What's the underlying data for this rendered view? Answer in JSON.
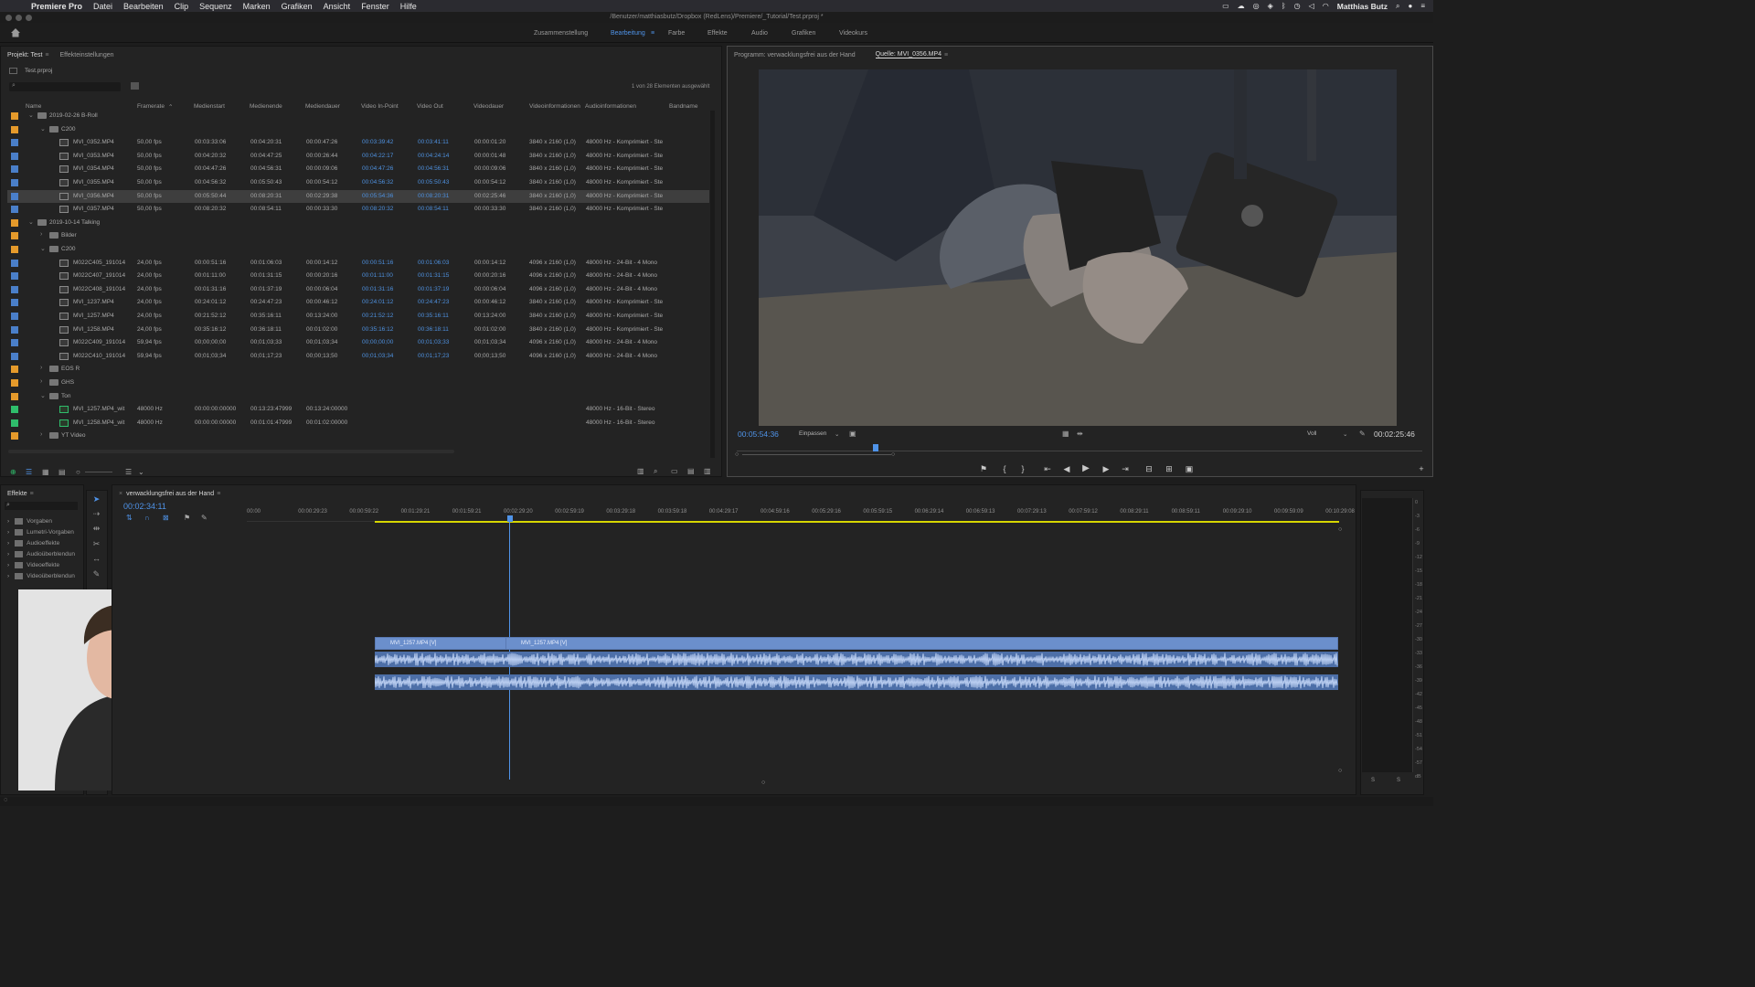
{
  "menubar": {
    "apple": "",
    "app": "Premiere Pro",
    "items": [
      "Datei",
      "Bearbeiten",
      "Clip",
      "Sequenz",
      "Marken",
      "Grafiken",
      "Ansicht",
      "Fenster",
      "Hilfe"
    ],
    "user": "Matthias Butz"
  },
  "window": {
    "title": "/Benutzer/matthiasbutz/Dropbox (RedLens)/Premiere/_Tutorial/Test.prproj *"
  },
  "workspaces": {
    "items": [
      "Zusammenstellung",
      "Bearbeitung",
      "Farbe",
      "Effekte",
      "Audio",
      "Grafiken",
      "Videokurs"
    ],
    "active": "Bearbeitung"
  },
  "project": {
    "tab_project": "Projekt: Test",
    "tab_effects": "Effekteinstellungen",
    "file": "Test.prproj",
    "selection_info": "1 von 28 Elementen ausgewählt",
    "columns": [
      "Name",
      "Framerate",
      "Medienstart",
      "Medienende",
      "Mediendauer",
      "Video In-Point",
      "Video Out",
      "Videodauer",
      "Videoinformationen",
      "Audioinformationen",
      "Bandname"
    ],
    "rows": [
      {
        "type": "folder",
        "indent": 1,
        "open": true,
        "color": "#e59a2b",
        "name": "2019-02-26 B-Roll"
      },
      {
        "type": "folder",
        "indent": 2,
        "open": true,
        "color": "#e59a2b",
        "name": "C200"
      },
      {
        "type": "clip",
        "indent": 3,
        "color": "#4a7fc9",
        "name": "MVI_0352.MP4",
        "fr": "50,00 fps",
        "ms": "00:03:33:06",
        "me": "00:04:20:31",
        "md": "00:00:47:26",
        "vi": "00:03:39:42",
        "vo": "00:03:41:11",
        "vd": "00:00:01:20",
        "vinfo": "3840 x 2160 (1,0)",
        "ainfo": "48000 Hz - Komprimiert - Ste"
      },
      {
        "type": "clip",
        "indent": 3,
        "color": "#4a7fc9",
        "name": "MVI_0353.MP4",
        "fr": "50,00 fps",
        "ms": "00:04:20:32",
        "me": "00:04:47:25",
        "md": "00:00:26:44",
        "vi": "00:04:22:17",
        "vo": "00:04:24:14",
        "vd": "00:00:01:48",
        "vinfo": "3840 x 2160 (1,0)",
        "ainfo": "48000 Hz - Komprimiert - Ste"
      },
      {
        "type": "clip",
        "indent": 3,
        "color": "#4a7fc9",
        "name": "MVI_0354.MP4",
        "fr": "50,00 fps",
        "ms": "00:04:47:26",
        "me": "00:04:56:31",
        "md": "00:00:09:06",
        "vi": "00:04:47:26",
        "vo": "00:04:56:31",
        "vd": "00:00:09:06",
        "vinfo": "3840 x 2160 (1,0)",
        "ainfo": "48000 Hz - Komprimiert - Ste"
      },
      {
        "type": "clip",
        "indent": 3,
        "color": "#4a7fc9",
        "name": "MVI_0355.MP4",
        "fr": "50,00 fps",
        "ms": "00:04:56:32",
        "me": "00:05:50:43",
        "md": "00:00:54:12",
        "vi": "00:04:56:32",
        "vo": "00:05:50:43",
        "vd": "00:00:54:12",
        "vinfo": "3840 x 2160 (1,0)",
        "ainfo": "48000 Hz - Komprimiert - Ste"
      },
      {
        "type": "clip",
        "indent": 3,
        "color": "#4a7fc9",
        "sel": true,
        "name": "MVI_0356.MP4",
        "fr": "50,00 fps",
        "ms": "00:05:50:44",
        "me": "00:08:20:31",
        "md": "00:02:29:38",
        "vi": "00:05:54:36",
        "vo": "00:08:20:31",
        "vd": "00:02:25:46",
        "vinfo": "3840 x 2160 (1,0)",
        "ainfo": "48000 Hz - Komprimiert - Ste"
      },
      {
        "type": "clip",
        "indent": 3,
        "color": "#4a7fc9",
        "name": "MVI_0357.MP4",
        "fr": "50,00 fps",
        "ms": "00:08:20:32",
        "me": "00:08:54:11",
        "md": "00:00:33:30",
        "vi": "00:08:20:32",
        "vo": "00:08:54:11",
        "vd": "00:00:33:30",
        "vinfo": "3840 x 2160 (1,0)",
        "ainfo": "48000 Hz - Komprimiert - Ste"
      },
      {
        "type": "folder",
        "indent": 1,
        "open": true,
        "color": "#e59a2b",
        "name": "2019-10-14 Talking"
      },
      {
        "type": "folder",
        "indent": 2,
        "open": false,
        "color": "#e59a2b",
        "name": "Bilder"
      },
      {
        "type": "folder",
        "indent": 2,
        "open": true,
        "color": "#e59a2b",
        "name": "C200"
      },
      {
        "type": "clip",
        "indent": 3,
        "color": "#4a7fc9",
        "name": "M022C405_191014",
        "fr": "24,00 fps",
        "ms": "00:00:51:16",
        "me": "00:01:06:03",
        "md": "00:00:14:12",
        "vi": "00:00:51:16",
        "vo": "00:01:06:03",
        "vd": "00:00:14:12",
        "vinfo": "4096 x 2160 (1,0)",
        "ainfo": "48000 Hz - 24-Bit - 4 Mono"
      },
      {
        "type": "clip",
        "indent": 3,
        "color": "#4a7fc9",
        "name": "M022C407_191014",
        "fr": "24,00 fps",
        "ms": "00:01:11:00",
        "me": "00:01:31:15",
        "md": "00:00:20:16",
        "vi": "00:01:11:00",
        "vo": "00:01:31:15",
        "vd": "00:00:20:16",
        "vinfo": "4096 x 2160 (1,0)",
        "ainfo": "48000 Hz - 24-Bit - 4 Mono"
      },
      {
        "type": "clip",
        "indent": 3,
        "color": "#4a7fc9",
        "name": "M022C408_191014",
        "fr": "24,00 fps",
        "ms": "00:01:31:16",
        "me": "00:01:37:19",
        "md": "00:00:06:04",
        "vi": "00:01:31:16",
        "vo": "00:01:37:19",
        "vd": "00:00:06:04",
        "vinfo": "4096 x 2160 (1,0)",
        "ainfo": "48000 Hz - 24-Bit - 4 Mono"
      },
      {
        "type": "clip",
        "indent": 3,
        "color": "#4a7fc9",
        "name": "MVI_1237.MP4",
        "fr": "24,00 fps",
        "ms": "00:24:01:12",
        "me": "00:24:47:23",
        "md": "00:00:46:12",
        "vi": "00:24:01:12",
        "vo": "00:24:47:23",
        "vd": "00:00:46:12",
        "vinfo": "3840 x 2160 (1,0)",
        "ainfo": "48000 Hz - Komprimiert - Ste"
      },
      {
        "type": "clip",
        "indent": 3,
        "color": "#4a7fc9",
        "name": "MVI_1257.MP4",
        "fr": "24,00 fps",
        "ms": "00:21:52:12",
        "me": "00:35:16:11",
        "md": "00:13:24:00",
        "vi": "00:21:52:12",
        "vo": "00:35:16:11",
        "vd": "00:13:24:00",
        "vinfo": "3840 x 2160 (1,0)",
        "ainfo": "48000 Hz - Komprimiert - Ste"
      },
      {
        "type": "clip",
        "indent": 3,
        "color": "#4a7fc9",
        "name": "MVI_1258.MP4",
        "fr": "24,00 fps",
        "ms": "00:35:16:12",
        "me": "00:36:18:11",
        "md": "00:01:02:00",
        "vi": "00:35:16:12",
        "vo": "00:36:18:11",
        "vd": "00:01:02:00",
        "vinfo": "3840 x 2160 (1,0)",
        "ainfo": "48000 Hz - Komprimiert - Ste"
      },
      {
        "type": "clip",
        "indent": 3,
        "color": "#4a7fc9",
        "name": "M022C409_191014",
        "fr": "59,94 fps",
        "ms": "00;00;00;00",
        "me": "00;01;03;33",
        "md": "00;01;03;34",
        "vi": "00;00;00;00",
        "vo": "00;01;03;33",
        "vd": "00;01;03;34",
        "vinfo": "4096 x 2160 (1,0)",
        "ainfo": "48000 Hz - 24-Bit - 4 Mono"
      },
      {
        "type": "clip",
        "indent": 3,
        "color": "#4a7fc9",
        "name": "M022C410_191014",
        "fr": "59,94 fps",
        "ms": "00;01;03;34",
        "me": "00;01;17;23",
        "md": "00;00;13;50",
        "vi": "00;01;03;34",
        "vo": "00;01;17;23",
        "vd": "00;00;13;50",
        "vinfo": "4096 x 2160 (1,0)",
        "ainfo": "48000 Hz - 24-Bit - 4 Mono"
      },
      {
        "type": "folder",
        "indent": 2,
        "open": false,
        "color": "#e59a2b",
        "name": "EOS R"
      },
      {
        "type": "folder",
        "indent": 2,
        "open": false,
        "color": "#e59a2b",
        "name": "GHS"
      },
      {
        "type": "folder",
        "indent": 2,
        "open": true,
        "color": "#e59a2b",
        "name": "Ton"
      },
      {
        "type": "audio",
        "indent": 3,
        "color": "#2fbd6b",
        "name": "MVI_1257.MP4_wit",
        "fr": "48000 Hz",
        "ms": "00:00:00:00000",
        "me": "00:13:23:47999",
        "md": "00:13:24:00000",
        "vi": "",
        "vo": "",
        "vd": "",
        "vinfo": "",
        "ainfo": "48000 Hz - 16-Bit - Stereo"
      },
      {
        "type": "audio",
        "indent": 3,
        "color": "#2fbd6b",
        "name": "MVI_1258.MP4_wit",
        "fr": "48000 Hz",
        "ms": "00:00:00:00000",
        "me": "00:01:01:47999",
        "md": "00:01:02:00000",
        "vi": "",
        "vo": "",
        "vd": "",
        "vinfo": "",
        "ainfo": "48000 Hz - 16-Bit - Stereo"
      },
      {
        "type": "folder",
        "indent": 2,
        "open": false,
        "color": "#e59a2b",
        "name": "YT Video"
      }
    ]
  },
  "monitor": {
    "tab_program": "Programm: verwacklungsfrei aus der Hand",
    "tab_source": "Quelle: MVI_0356.MP4",
    "timecode": "00:05:54:36",
    "fit": "Einpassen",
    "quality": "Voll",
    "duration": "00:02:25:46"
  },
  "effects": {
    "tab": "Effekte",
    "items": [
      "Vorgaben",
      "Lumetri-Vorgaben",
      "Audioeffekte",
      "Audioüberblendun",
      "Videoeffekte",
      "Videoüberblendun"
    ]
  },
  "timeline": {
    "tab": "verwacklungsfrei aus der Hand",
    "timecode": "00:02:34:11",
    "ticks": [
      "00:00",
      "00:00:29:23",
      "00:00:59:22",
      "00:01:29:21",
      "00:01:59:21",
      "00:02:29:20",
      "00:02:59:19",
      "00:03:29:18",
      "00:03:59:18",
      "00:04:29:17",
      "00:04:59:16",
      "00:05:29:16",
      "00:05:59:15",
      "00:06:29:14",
      "00:06:59:13",
      "00:07:29:13",
      "00:07:59:12",
      "00:08:29:11",
      "00:08:59:11",
      "00:09:29:10",
      "00:09:59:09",
      "00:10:29:08"
    ],
    "clip1": "MVI_1257.MP4 [V]",
    "clip2": "MVI_1257.MP4 [V]"
  },
  "meter": {
    "labels": [
      "0",
      "-3",
      "-6",
      "-9",
      "-12",
      "-15",
      "-18",
      "-21",
      "-24",
      "-27",
      "-30",
      "-33",
      "-36",
      "-39",
      "-42",
      "-45",
      "-48",
      "-51",
      "-54",
      "-57",
      "dB"
    ],
    "solo": [
      "S",
      "S"
    ]
  },
  "colors": {
    "accent": "#4f93e8",
    "folder": "#e59a2b",
    "clip": "#4a7fc9",
    "audio": "#2fbd6b"
  }
}
